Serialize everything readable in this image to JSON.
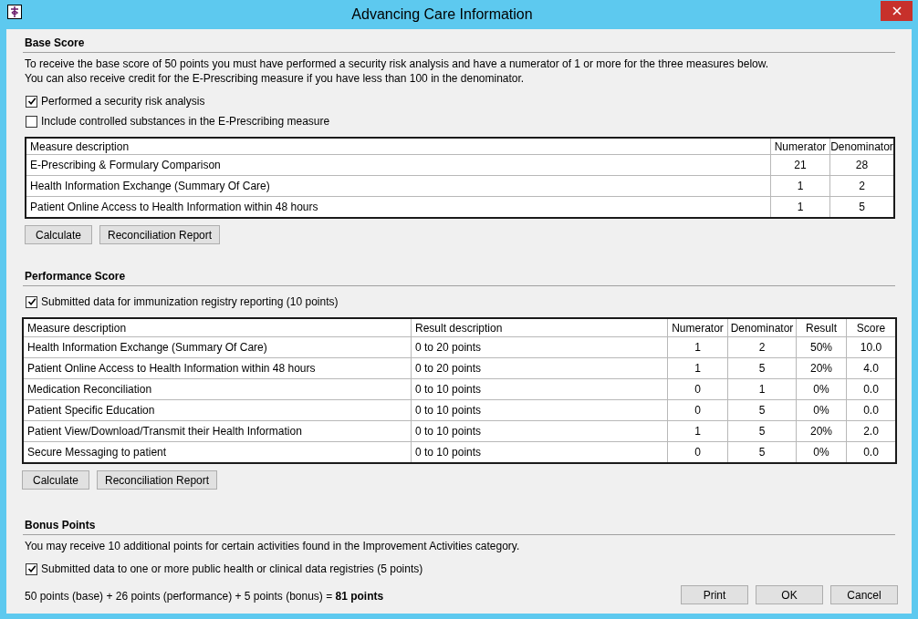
{
  "window": {
    "title": "Advancing Care Information"
  },
  "base_score": {
    "heading": "Base Score",
    "description": [
      "To receive the base score of 50 points you must have performed a security risk analysis and have a numerator of 1 or more for the three measures below.",
      "You can also receive credit for the E-Prescribing measure if you have less than 100 in the denominator."
    ],
    "checkboxes": [
      {
        "label": "Performed a security risk analysis",
        "checked": true
      },
      {
        "label": "Include controlled substances in the E-Prescribing measure",
        "checked": false
      }
    ],
    "table": {
      "columns": [
        "Measure description",
        "Numerator",
        "Denominator"
      ],
      "rows": [
        [
          "E-Prescribing & Formulary Comparison",
          "21",
          "28"
        ],
        [
          "Health Information Exchange (Summary Of Care)",
          "1",
          "2"
        ],
        [
          "Patient Online Access to Health Information within 48 hours",
          "1",
          "5"
        ]
      ]
    },
    "buttons": [
      "Calculate",
      "Reconciliation Report"
    ]
  },
  "performance_score": {
    "heading": "Performance Score",
    "checkboxes": [
      {
        "label": "Submitted data for immunization registry reporting (10 points)",
        "checked": true
      }
    ],
    "table": {
      "columns": [
        "Measure description",
        "Result description",
        "Numerator",
        "Denominator",
        "Result",
        "Score"
      ],
      "rows": [
        [
          "Health Information Exchange (Summary Of Care)",
          "0 to 20 points",
          "1",
          "2",
          "50%",
          "10.0"
        ],
        [
          "Patient Online Access to Health Information within 48 hours",
          "0 to 20 points",
          "1",
          "5",
          "20%",
          "4.0"
        ],
        [
          "Medication Reconciliation",
          "0 to 10 points",
          "0",
          "1",
          "0%",
          "0.0"
        ],
        [
          "Patient Specific Education",
          "0 to 10 points",
          "0",
          "5",
          "0%",
          "0.0"
        ],
        [
          "Patient View/Download/Transmit their Health Information",
          "0 to 10 points",
          "1",
          "5",
          "20%",
          "2.0"
        ],
        [
          "Secure Messaging to patient",
          "0 to 10 points",
          "0",
          "5",
          "0%",
          "0.0"
        ]
      ]
    },
    "buttons": [
      "Calculate",
      "Reconciliation Report"
    ]
  },
  "bonus_points": {
    "heading": "Bonus Points",
    "description": [
      "You may receive 10 additional points for certain activities found in the Improvement Activities category."
    ],
    "checkboxes": [
      {
        "label": "Submitted data to one or more public health or clinical data registries (5 points)",
        "checked": true
      }
    ]
  },
  "summary": "50 points (base) + 26 points (performance) + 5 points (bonus) = **81 points**",
  "buttons": [
    "Print",
    "OK",
    "Cancel"
  ]
}
